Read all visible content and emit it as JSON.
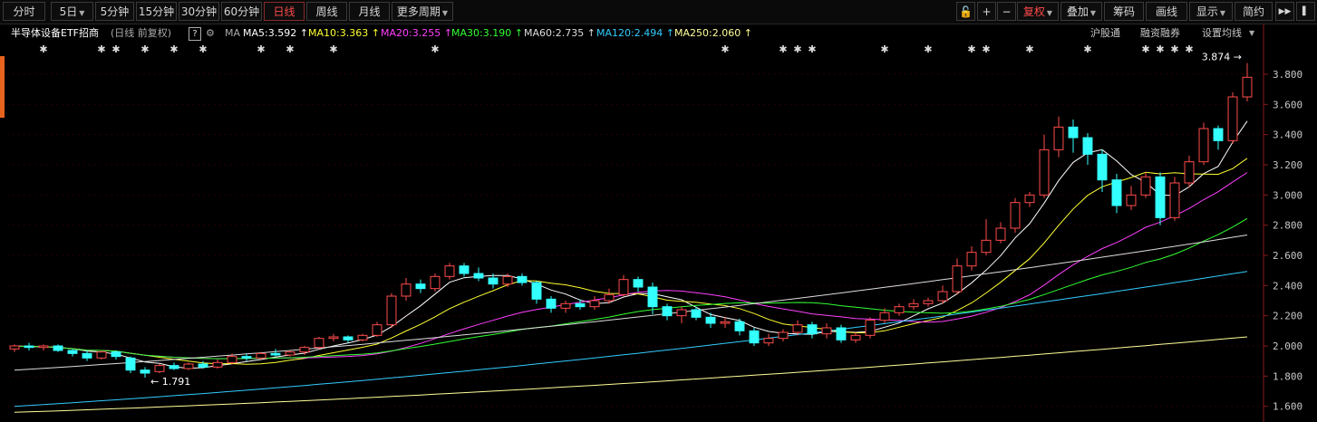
{
  "toolbar": {
    "periods": [
      "分时",
      "5日",
      "5分钟",
      "15分钟",
      "30分钟",
      "60分钟",
      "日线",
      "周线",
      "月线",
      "更多周期"
    ],
    "active_period": "日线",
    "right_buttons": [
      "复权",
      "叠加",
      "筹码",
      "画线",
      "显示",
      "简约"
    ],
    "icon_names": [
      "lock-icon",
      "plus-icon",
      "minus-icon",
      "expand-icon",
      "fullscreen-icon"
    ]
  },
  "info": {
    "title": "半导体设备ETF招商",
    "subtitle": "(日线 前复权)",
    "help": "?",
    "ma_label": "MA",
    "ma": [
      {
        "label": "MA5:3.592",
        "color": "#ffffff"
      },
      {
        "label": "MA10:3.363",
        "color": "#ffff33"
      },
      {
        "label": "MA20:3.255",
        "color": "#ff40ff"
      },
      {
        "label": "MA30:3.190",
        "color": "#33ff33"
      },
      {
        "label": "MA60:2.735",
        "color": "#dddddd"
      },
      {
        "label": "MA120:2.494",
        "color": "#33ccff"
      },
      {
        "label": "MA250:2.060",
        "color": "#ffff99"
      }
    ],
    "right_links": [
      "沪股通",
      "融资融券",
      "设置均线"
    ]
  },
  "colors": {
    "up": "#ff4b4b",
    "down": "#33ffff",
    "grid": "#2a0000",
    "axis_text": "#c8c8c8"
  },
  "chart_data": {
    "type": "candlestick",
    "ylim": [
      1.52,
      3.92
    ],
    "y_ticks": [
      "3.800",
      "3.600",
      "3.400",
      "3.200",
      "3.000",
      "2.800",
      "2.600",
      "2.400",
      "2.200",
      "2.000",
      "1.800",
      "1.600"
    ],
    "max_label": "3.874",
    "min_label": "1.791",
    "event_markers": [
      2,
      6,
      7,
      9,
      11,
      13,
      17,
      19,
      22,
      29,
      49,
      53,
      54,
      55,
      60,
      63,
      66,
      67,
      70,
      74,
      78,
      79,
      80,
      81
    ],
    "candles": [
      [
        1.98,
        2.0,
        1.96,
        2.01
      ],
      [
        2.0,
        1.99,
        1.97,
        2.02
      ],
      [
        1.99,
        2.0,
        1.97,
        2.01
      ],
      [
        2.0,
        1.97,
        1.96,
        2.01
      ],
      [
        1.97,
        1.95,
        1.93,
        1.98
      ],
      [
        1.95,
        1.92,
        1.9,
        1.97
      ],
      [
        1.92,
        1.96,
        1.91,
        1.97
      ],
      [
        1.96,
        1.93,
        1.91,
        1.97
      ],
      [
        1.92,
        1.84,
        1.82,
        1.93
      ],
      [
        1.84,
        1.82,
        1.79,
        1.86
      ],
      [
        1.83,
        1.87,
        1.82,
        1.88
      ],
      [
        1.87,
        1.85,
        1.84,
        1.89
      ],
      [
        1.85,
        1.88,
        1.84,
        1.89
      ],
      [
        1.88,
        1.86,
        1.85,
        1.9
      ],
      [
        1.86,
        1.89,
        1.85,
        1.91
      ],
      [
        1.89,
        1.93,
        1.88,
        1.95
      ],
      [
        1.93,
        1.92,
        1.9,
        1.95
      ],
      [
        1.92,
        1.95,
        1.91,
        1.96
      ],
      [
        1.95,
        1.94,
        1.93,
        1.98
      ],
      [
        1.94,
        1.96,
        1.93,
        1.97
      ],
      [
        1.96,
        1.99,
        1.94,
        2.0
      ],
      [
        1.99,
        2.05,
        1.98,
        2.06
      ],
      [
        2.05,
        2.06,
        2.03,
        2.08
      ],
      [
        2.06,
        2.04,
        2.02,
        2.07
      ],
      [
        2.04,
        2.07,
        2.03,
        2.08
      ],
      [
        2.07,
        2.14,
        2.06,
        2.16
      ],
      [
        2.14,
        2.33,
        2.12,
        2.35
      ],
      [
        2.33,
        2.41,
        2.3,
        2.45
      ],
      [
        2.41,
        2.38,
        2.35,
        2.44
      ],
      [
        2.38,
        2.46,
        2.36,
        2.48
      ],
      [
        2.46,
        2.53,
        2.44,
        2.55
      ],
      [
        2.53,
        2.48,
        2.46,
        2.55
      ],
      [
        2.48,
        2.45,
        2.43,
        2.52
      ],
      [
        2.45,
        2.41,
        2.38,
        2.48
      ],
      [
        2.41,
        2.46,
        2.39,
        2.48
      ],
      [
        2.46,
        2.42,
        2.4,
        2.48
      ],
      [
        2.42,
        2.31,
        2.28,
        2.43
      ],
      [
        2.31,
        2.25,
        2.22,
        2.33
      ],
      [
        2.25,
        2.28,
        2.22,
        2.3
      ],
      [
        2.28,
        2.26,
        2.24,
        2.31
      ],
      [
        2.26,
        2.3,
        2.24,
        2.33
      ],
      [
        2.3,
        2.34,
        2.28,
        2.38
      ],
      [
        2.34,
        2.44,
        2.33,
        2.47
      ],
      [
        2.44,
        2.39,
        2.36,
        2.46
      ],
      [
        2.39,
        2.26,
        2.21,
        2.42
      ],
      [
        2.26,
        2.2,
        2.17,
        2.28
      ],
      [
        2.2,
        2.24,
        2.15,
        2.26
      ],
      [
        2.24,
        2.19,
        2.17,
        2.26
      ],
      [
        2.19,
        2.15,
        2.12,
        2.22
      ],
      [
        2.15,
        2.16,
        2.12,
        2.19
      ],
      [
        2.16,
        2.1,
        2.07,
        2.18
      ],
      [
        2.1,
        2.02,
        2.0,
        2.12
      ],
      [
        2.02,
        2.05,
        2.0,
        2.08
      ],
      [
        2.05,
        2.09,
        2.03,
        2.11
      ],
      [
        2.09,
        2.14,
        2.07,
        2.17
      ],
      [
        2.14,
        2.08,
        2.05,
        2.16
      ],
      [
        2.08,
        2.12,
        2.05,
        2.15
      ],
      [
        2.12,
        2.04,
        2.02,
        2.14
      ],
      [
        2.04,
        2.07,
        2.02,
        2.09
      ],
      [
        2.07,
        2.17,
        2.05,
        2.19
      ],
      [
        2.17,
        2.22,
        2.15,
        2.25
      ],
      [
        2.22,
        2.26,
        2.2,
        2.28
      ],
      [
        2.26,
        2.28,
        2.24,
        2.31
      ],
      [
        2.28,
        2.3,
        2.26,
        2.32
      ],
      [
        2.3,
        2.36,
        2.28,
        2.4
      ],
      [
        2.36,
        2.53,
        2.34,
        2.58
      ],
      [
        2.53,
        2.62,
        2.5,
        2.66
      ],
      [
        2.62,
        2.7,
        2.6,
        2.84
      ],
      [
        2.7,
        2.78,
        2.68,
        2.82
      ],
      [
        2.78,
        2.95,
        2.75,
        2.98
      ],
      [
        2.95,
        3.0,
        2.92,
        3.02
      ],
      [
        3.0,
        3.3,
        2.98,
        3.4
      ],
      [
        3.3,
        3.45,
        3.25,
        3.52
      ],
      [
        3.45,
        3.38,
        3.28,
        3.5
      ],
      [
        3.38,
        3.27,
        3.2,
        3.41
      ],
      [
        3.27,
        3.1,
        3.02,
        3.3
      ],
      [
        3.1,
        2.93,
        2.88,
        3.14
      ],
      [
        2.93,
        3.0,
        2.9,
        3.06
      ],
      [
        3.0,
        3.12,
        2.98,
        3.15
      ],
      [
        3.12,
        2.85,
        2.8,
        3.15
      ],
      [
        2.85,
        3.08,
        2.83,
        3.12
      ],
      [
        3.08,
        3.22,
        3.05,
        3.26
      ],
      [
        3.22,
        3.44,
        3.2,
        3.48
      ],
      [
        3.44,
        3.36,
        3.3,
        3.46
      ],
      [
        3.36,
        3.65,
        3.34,
        3.68
      ],
      [
        3.65,
        3.78,
        3.62,
        3.874
      ]
    ]
  }
}
